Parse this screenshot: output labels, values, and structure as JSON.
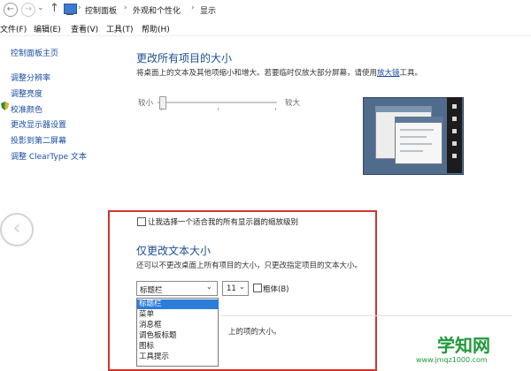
{
  "address": {
    "breadcrumbs": [
      "控制面板",
      "外观和个性化",
      "显示"
    ]
  },
  "menu": {
    "items": [
      "文件(F)",
      "编辑(E)",
      "查看(V)",
      "工具(T)",
      "帮助(H)"
    ]
  },
  "sidebar": {
    "home": "控制面板主页",
    "links": [
      "调整分辨率",
      "调整亮度",
      "校准颜色",
      "更改显示器设置",
      "投影到第二屏幕",
      "调整 ClearType 文本"
    ]
  },
  "main": {
    "title": "更改所有项目的大小",
    "desc_before": "将桌面上的文本及其他项缩小和增大。若要临时仅放大部分屏幕，请使用",
    "magnifier_link": "放大镜",
    "desc_after": "工具。",
    "slider_small": "较小",
    "slider_large": "较大"
  },
  "custom": {
    "scale_checkbox_label": "让我选择一个适合我的所有显示器的缩放级别",
    "title": "仅更改文本大小",
    "desc": "还可以不更改桌面上所有项目的大小，只更改指定项目的文本大小。",
    "item_select_value": "标题栏",
    "size_select_value": "11",
    "bold_label": "粗体(B)",
    "dropdown_options": [
      "标题栏",
      "菜单",
      "消息框",
      "调色板标题",
      "图标",
      "工具提示"
    ],
    "dropdown_selected_index": 0,
    "obscured_text": "上的项的大小。"
  },
  "watermark": {
    "text": "学知网",
    "url": "www.jmqz1000.com"
  },
  "icons": {
    "back": "back-arrow-icon",
    "forward": "forward-arrow-icon",
    "up": "up-arrow-icon",
    "computer": "computer-icon",
    "shield": "shield-icon",
    "dropdown": "chevron-down-icon"
  },
  "colors": {
    "link": "#1a4da1",
    "heading": "#1d4f91",
    "highlight_box": "#d1352f",
    "selected_option": "#2c7cd9",
    "watermark": "#1f9a3a"
  }
}
